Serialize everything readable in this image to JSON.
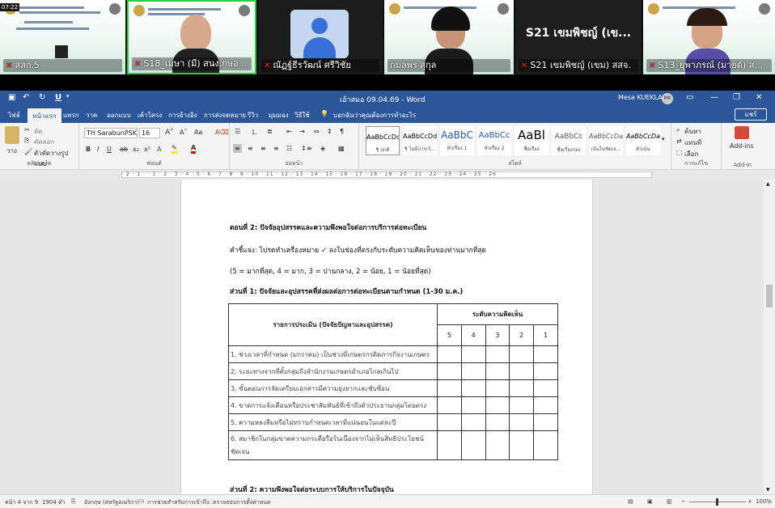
{
  "meeting": {
    "time_badge": "07:22",
    "participants": [
      {
        "name": "สสก.5",
        "muted": true
      },
      {
        "name": "S18_เมษา (มี) สนง.กษอ...",
        "muted": true
      },
      {
        "name": "ณัฏฐ์ธีรวัฒน์ ศรีวิชัย",
        "muted": true
      },
      {
        "name": "กมลพร สุกุล",
        "muted": false
      },
      {
        "name": "S21 เขมพิชญ์ (เขม) สสจ.",
        "muted": true
      },
      {
        "name": "S13_ยุพาภรณ์ (มายด์) ส...",
        "muted": true
      }
    ],
    "big_name": "S21 เขมพิชญ์ (เข..."
  },
  "window": {
    "title": "เอ้าสมอ 09.04.69  -  Word",
    "user": "Mesa KUEKLANG",
    "avatar": "MK"
  },
  "menu": {
    "tabs": [
      "ไฟล์",
      "หน้าแรก",
      "แทรก",
      "วาด",
      "ออกแบบ",
      "เค้าโครง",
      "การอ้างอิง",
      "การส่งจดหมาย",
      "รีวิว",
      "มุมมอง",
      "วิธีใช้"
    ],
    "active": "หน้าแรก",
    "tell_me": "บอกฉันว่าคุณต้องการทำอะไร",
    "share": "แชร์"
  },
  "ribbon": {
    "clipboard": {
      "paste": "วาง",
      "cut": "ตัด",
      "copy": "คัดลอก",
      "format_painter": "ตัวคัดวางรูปแบบ",
      "label": "คลิปบอร์ด"
    },
    "font": {
      "name": "TH SarabunPSK",
      "size": "16",
      "label": "ฟอนต์"
    },
    "paragraph": {
      "label": "ย่อหน้า"
    },
    "styles": {
      "items": [
        {
          "sample": "AaBbCcDd",
          "label": "¶ ปกติ"
        },
        {
          "sample": "AaBbCcDd",
          "label": "¶ ไม่มีการเว้..."
        },
        {
          "sample": "AaBbC",
          "label": "หัวเรื่อง 1"
        },
        {
          "sample": "AaBbCc",
          "label": "หัวเรื่อง 2"
        },
        {
          "sample": "AaBl",
          "label": "ชื่อเรื่อง"
        },
        {
          "sample": "AaBbCc",
          "label": "ชื่อเรื่องรอง"
        },
        {
          "sample": "AaBbCcDa",
          "label": "เน้นไม่ชัดเจ..."
        },
        {
          "sample": "AaBbCcDa",
          "label": "ตัวเน้น"
        }
      ],
      "label": "สไตล์"
    },
    "editing": {
      "find": "ค้นหา",
      "replace": "แทนที่",
      "select": "เลือก",
      "label": "การแก้ไข"
    },
    "addins": {
      "button": "Add-ins",
      "label": "Add-in"
    }
  },
  "ruler": {
    "marks": "· 2 · 1 · · 1 · 2 · 3 · 4 · 5 · 6 · 7 · 8 · 9 · 10 · 11 · 12 · 13 · 14 · 15 · 16 · 17 · 18 · 19 · 20 · 21 · 22 · 23 · 24 · 25 · 26"
  },
  "doc": {
    "h_section": "ตอนที่ 2: ปัจจัยอุปสรรคและความพึงพอใจต่อการบริการต่อทะเบียน",
    "instruction": "คำชี้แจง: โปรดทำเครื่องหมาย ✓ ลงในช่องที่ตรงกับระดับความคิดเห็นของท่านมากที่สุด",
    "scale": "(5 = มากที่สุด, 4 = มาก, 3 = ปานกลาง, 2 = น้อย, 1 = น้อยที่สุด)",
    "part1": "ส่วนที่ 1: ปัจจัยและอุปสรรคที่ส่งผลต่อการต่อทะเบียนตามกำหนด (1-30 ม.ค.)",
    "table": {
      "col_item": "รายการประเมิน (ปัจจัยปัญหาและอุปสรรค)",
      "col_level": "ระดับความคิดเห็น",
      "levels": [
        "5",
        "4",
        "3",
        "2",
        "1"
      ],
      "rows": [
        "1. ช่วงเวลาที่กำหนด (มกราคม) เป็นช่วงที่เกษตรกรติดภารกิจงานเกษตร",
        "2. ระยะทางจากที่ตั้งกลุ่มถึงสำนักงานเกษตรอำเภอไกลเกินไป",
        "3. ขั้นตอนการจัดเตรียมเอกสารมีความยุ่งยากและซับซ้อน",
        "4. ขาดการแจ้งเตือนหรือประชาสัมพันธ์ที่เข้าถึงตัวประธานกลุ่มโดยตรง",
        "5. ความหลงลืมหรือไม่ทราบกำหนดเวลาที่แน่นอนในแต่ละปี",
        "6. สมาชิกในกลุ่มขาดความกระตือรือร้นเนื่องจากไม่เห็นสิทธิประโยชน์ชัดเจน"
      ]
    },
    "part2": "ส่วนที่ 2: ความพึงพอใจต่อระบบการให้บริการในปัจจุบัน"
  },
  "status": {
    "page": "หน้า 4 จาก 9",
    "words": "1904 คำ",
    "lang": "อังกฤษ (สหรัฐอเมริกา)",
    "a11y": "การช่วยสำหรับการเข้าถึง: ตรวจสอบการตั้งค่าหนด",
    "zoom": "100%"
  }
}
